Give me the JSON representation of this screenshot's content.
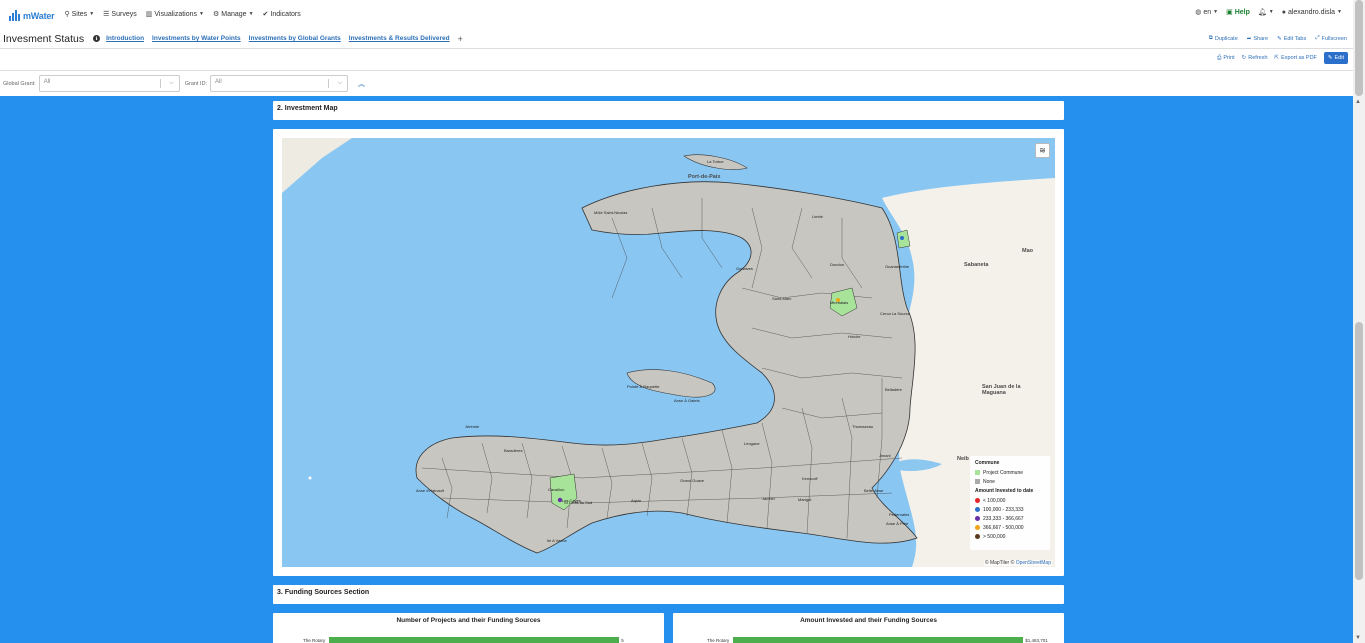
{
  "app": {
    "logo_text": "mWater"
  },
  "nav": {
    "items": [
      {
        "label": "Sites",
        "icon": "map-marker-icon"
      },
      {
        "label": "Surveys",
        "icon": "list-icon"
      },
      {
        "label": "Visualizations",
        "icon": "bar-chart-icon"
      },
      {
        "label": "Manage",
        "icon": "gear-icon"
      },
      {
        "label": "Indicators",
        "icon": "check-circle-icon"
      }
    ],
    "language": "en",
    "help": "Help",
    "user": "alexandro.disla"
  },
  "dashboard": {
    "title": "Invesment Status",
    "tabs": [
      "Introduction",
      "Investments by Water Points",
      "Investments by Global Grants",
      "Investments & Results Delivered"
    ],
    "tab_add": "+",
    "actions": [
      "Duplicate",
      "Share",
      "Edit Tabs",
      "Fullscreen"
    ],
    "actions2": [
      "Print",
      "Refresh",
      "Export as PDF"
    ],
    "edit_label": "Edit"
  },
  "filters": {
    "global_grant_label": "Global Grant:",
    "global_grant_value": "All",
    "grant_id_label": "Grant ID:",
    "grant_id_value": "All"
  },
  "sections": {
    "investment_map_title": "2. Investment Map",
    "funding_sources_title": "3. Funding Sources Section"
  },
  "map": {
    "labels": {
      "port_de_paix": "Port-de-Paix",
      "la_tortue": "La Tortue",
      "mole": "Môle Saint-Nicolas",
      "la_gonave_label": "Anse À Galets",
      "pointe": "Pointe À Raquette",
      "sabaneta": "Sabaneta",
      "mao": "Mao",
      "san_juan": "San Juan de la Maguana",
      "neiba": "Neib",
      "jimani": "Jimani",
      "pedernales": "Pedernales",
      "ile_a_vache": "Ile A Vache",
      "hinche": "Hinche",
      "mirebalais": "Mirebalais",
      "leogane": "Léogane",
      "jacmel": "Jacmel",
      "jeremie": "Jérémie",
      "les_cayes": "Les Cayes",
      "st_marc": "Saint-Marc",
      "gonaives": "Gonaives",
      "limbe": "Limbé",
      "dondon": "Dondon",
      "ouanaminthe": "Ouanaminthe",
      "cerca_la_source": "Cerca La Source",
      "belladere": "Belladère",
      "thomazeau": "Thomazeau",
      "kenscoff": "Kenscoff",
      "aquin": "Aquin",
      "cavaillon": "Cavaillon",
      "marigot": "Marigot",
      "belle_anse": "Belle-Anse",
      "anse_a_pitre": "Anse À Pitre",
      "grand_goave": "Grand Goave",
      "saint_louis_du_sud": "St Louis du Sud",
      "baraderes": "Baradères",
      "anse_dhainault": "Anse d'Hainault"
    },
    "legend": {
      "commune_title": "Commune",
      "project_commune": "Project Commune",
      "none": "None",
      "amount_title": "Amount Invested to date",
      "bins": [
        {
          "label": "< 100,000",
          "color": "#e3262a"
        },
        {
          "label": "100,000 - 233,333",
          "color": "#2a6fc9"
        },
        {
          "label": "233,333 - 366,667",
          "color": "#6a2fa8"
        },
        {
          "label": "366,667 - 500,000",
          "color": "#f2a516"
        },
        {
          "label": "> 500,000",
          "color": "#5a3a1e"
        }
      ],
      "project_color": "#a8e39a",
      "none_color": "#c8c6c0"
    },
    "attribution": "© MapTiler © OpenStreetMap",
    "attribution_prefix": "© MapTiler ©",
    "attribution_link": "OpenStreetMap"
  },
  "charts": {
    "left_title": "Number of Projects and their Funding Sources",
    "right_title": "Amount Invested and their Funding Sources",
    "row_label": "The Rotary",
    "left_value": "5",
    "right_value": "$1,463,701"
  },
  "chart_data": [
    {
      "type": "bar",
      "title": "Number of Projects and their Funding Sources",
      "categories": [
        "The Rotary"
      ],
      "values": [
        5
      ]
    },
    {
      "type": "bar",
      "title": "Amount Invested and their Funding Sources",
      "categories": [
        "The Rotary"
      ],
      "values": [
        1463701
      ]
    }
  ]
}
